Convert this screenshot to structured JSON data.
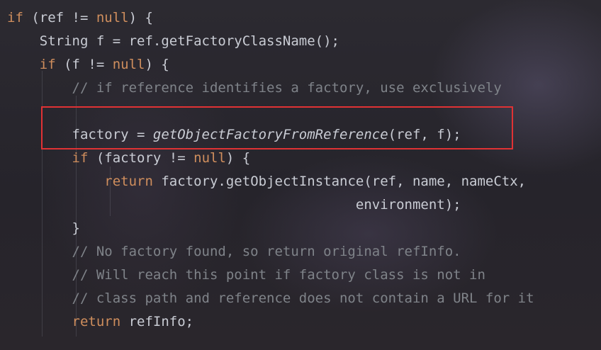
{
  "code": {
    "l1": {
      "kw_if": "if",
      "rest1": " (ref != ",
      "kw_null": "null",
      "rest2": ") {"
    },
    "l2": {
      "text": "    String f = ref.getFactoryClassName();"
    },
    "l3": {
      "indent": "    ",
      "kw_if": "if",
      "rest1": " (f != ",
      "kw_null": "null",
      "rest2": ") {"
    },
    "l4": {
      "comment": "        // if reference identifies a factory, use exclusively"
    },
    "l6": {
      "pre": "        factory = ",
      "call": "getObjectFactoryFromReference",
      "post": "(ref, f);"
    },
    "l7": {
      "indent": "        ",
      "kw_if": "if",
      "rest1": " (factory != ",
      "kw_null": "null",
      "rest2": ") {"
    },
    "l8": {
      "indent": "            ",
      "kw_return": "return",
      "rest": " factory.getObjectInstance(ref, name, nameCtx,"
    },
    "l9": {
      "text": "                                           environment);"
    },
    "l10": {
      "text": "        }"
    },
    "l11": {
      "comment": "        // No factory found, so return original refInfo."
    },
    "l12": {
      "comment": "        // Will reach this point if factory class is not in"
    },
    "l13": {
      "comment": "        // class path and reference does not contain a URL for it"
    },
    "l14": {
      "indent": "        ",
      "kw_return": "return",
      "rest": " refInfo;"
    }
  },
  "colors": {
    "keyword": "#cf8e5d",
    "comment": "#7f8389",
    "text": "#c9ccd4",
    "highlight_border": "#e03234"
  }
}
